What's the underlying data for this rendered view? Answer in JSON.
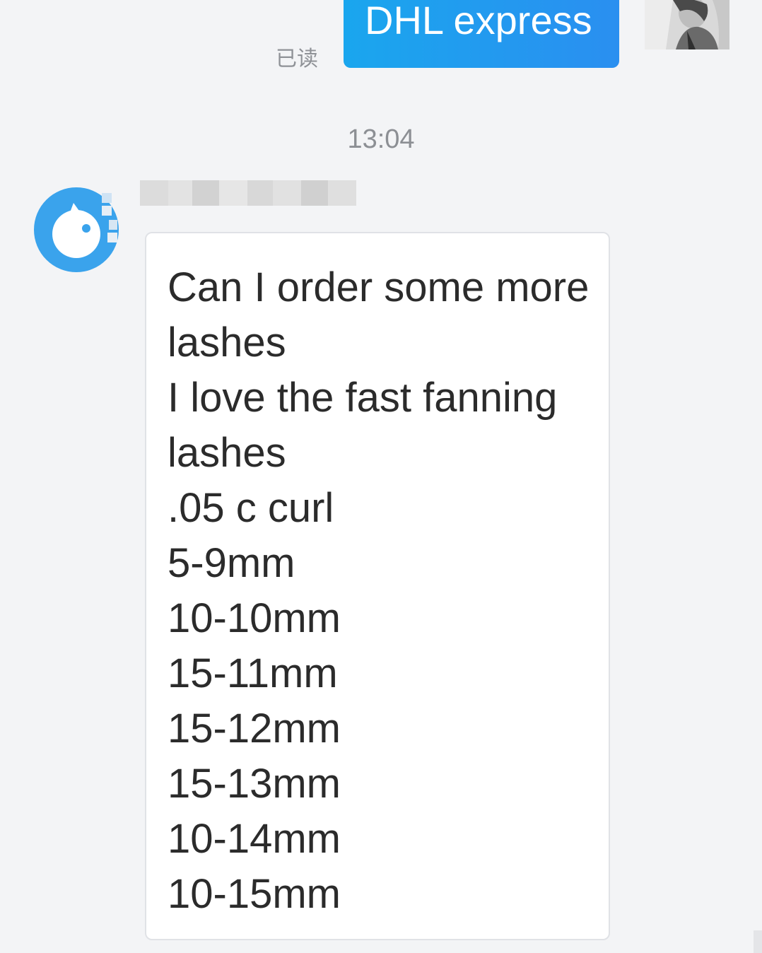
{
  "sent_message": {
    "text": "DHL express",
    "read_status": "已读",
    "bubble_color": "#1a9bf0"
  },
  "timestamp": "13:04",
  "received_message": {
    "lines": [
      "Can I order some more",
      "lashes",
      "I love the fast fanning",
      "lashes",
      ".05 c curl",
      "5-9mm",
      "10-10mm",
      "15-11mm",
      "15-12mm",
      "15-13mm",
      "10-14mm",
      "10-15mm"
    ]
  },
  "icons": {
    "my_avatar": "user-photo-avatar",
    "contact_avatar": "app-logo-avatar"
  },
  "colors": {
    "background": "#f3f4f6",
    "received_bubble": "#ffffff",
    "contact_avatar": "#3aa3ec"
  }
}
